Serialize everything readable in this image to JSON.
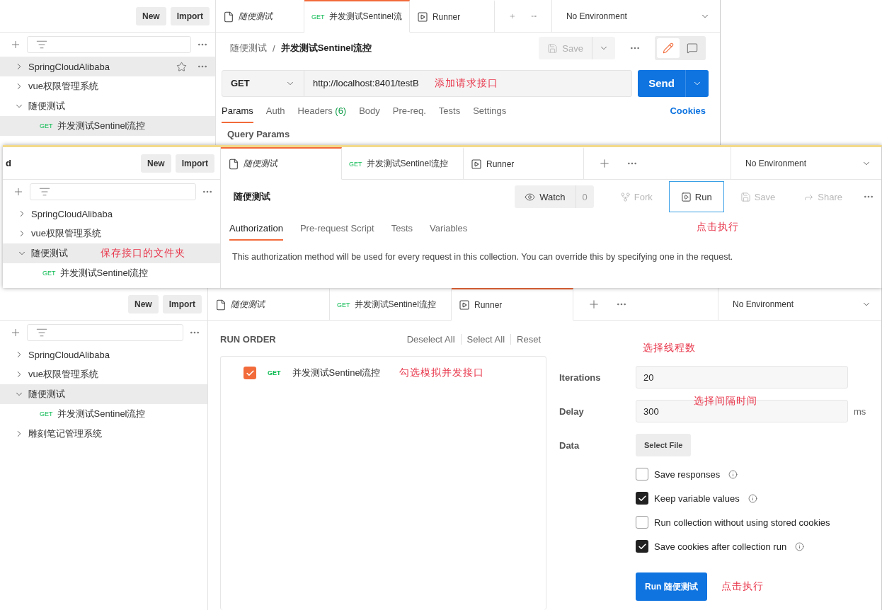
{
  "request_view": {
    "sidebar": {
      "buttons": [
        "New",
        "Import"
      ],
      "items": [
        {
          "label": "SpringCloudAlibaba",
          "expanded": false,
          "selected": true,
          "hovered": true
        },
        {
          "label": "vue权限管理系统",
          "expanded": false,
          "selected": false,
          "hovered": false
        },
        {
          "label": "随便测试",
          "expanded": true,
          "selected": false,
          "hovered": false,
          "children": [
            {
              "method": "GET",
              "label": "并发测试Sentinel流控",
              "selected": true
            }
          ]
        }
      ]
    },
    "tabs": [
      {
        "kind": "collection",
        "label": "随便测试",
        "selected": false
      },
      {
        "kind": "request",
        "method": "GET",
        "label": "并发测试Sentinel流",
        "selected": true
      },
      {
        "kind": "runner",
        "label": "Runner",
        "selected": false
      }
    ],
    "environment": "No Environment",
    "breadcrumb": [
      "随便测试",
      "/",
      "并发测试Sentinel流控"
    ],
    "save_button": {
      "label": "Save",
      "disabled": true
    },
    "method": "GET",
    "url": "http://localhost:8401/testB",
    "url_annotation": "添加请求接口",
    "send_button": "Send",
    "subtabs": [
      {
        "label": "Params",
        "selected": true
      },
      {
        "label": "Auth",
        "selected": false
      },
      {
        "label": "Headers",
        "count": "(6)",
        "selected": false
      },
      {
        "label": "Body",
        "selected": false
      },
      {
        "label": "Pre-req.",
        "selected": false
      },
      {
        "label": "Tests",
        "selected": false
      },
      {
        "label": "Settings",
        "selected": false
      }
    ],
    "cookies_link": "Cookies",
    "section_title": "Query Params"
  },
  "collection_view": {
    "sidebar": {
      "header_title": "d",
      "buttons": [
        "New",
        "Import"
      ],
      "items": [
        {
          "label": "SpringCloudAlibaba",
          "expanded": false,
          "selected": false
        },
        {
          "label": "vue权限管理系统",
          "expanded": false,
          "selected": false
        },
        {
          "label": "随便测试",
          "expanded": true,
          "selected": true,
          "annotation": "保存接口的文件夹",
          "children": [
            {
              "method": "GET",
              "label": "并发测试Sentinel流控",
              "selected": false
            }
          ]
        }
      ]
    },
    "tabs": [
      {
        "kind": "collection",
        "label": "随便测试",
        "selected": true
      },
      {
        "kind": "request",
        "method": "GET",
        "label": "并发测试Sentinel流控",
        "selected": false
      },
      {
        "kind": "runner",
        "label": "Runner",
        "selected": false
      }
    ],
    "environment": "No Environment",
    "title": "随便测试",
    "watch_button": {
      "label": "Watch",
      "count": "0"
    },
    "actions": [
      {
        "kind": "fork",
        "label": "Fork",
        "disabled": true,
        "highlighted": false
      },
      {
        "kind": "run",
        "label": "Run",
        "disabled": false,
        "highlighted": true
      },
      {
        "kind": "save",
        "label": "Save",
        "disabled": true,
        "highlighted": false
      },
      {
        "kind": "share",
        "label": "Share",
        "disabled": true,
        "highlighted": false
      }
    ],
    "run_annotation": "点击执行",
    "subtabs": [
      {
        "label": "Authorization",
        "selected": true
      },
      {
        "label": "Pre-request Script",
        "selected": false
      },
      {
        "label": "Tests",
        "selected": false
      },
      {
        "label": "Variables",
        "selected": false
      }
    ],
    "description": "This authorization method will be used for every request in this collection. You can override this by specifying one in the request."
  },
  "runner_view": {
    "sidebar": {
      "buttons": [
        "New",
        "Import"
      ],
      "items": [
        {
          "label": "SpringCloudAlibaba",
          "expanded": false,
          "selected": false
        },
        {
          "label": "vue权限管理系统",
          "expanded": false,
          "selected": false
        },
        {
          "label": "随便测试",
          "expanded": true,
          "selected": true,
          "children": [
            {
              "method": "GET",
              "label": "并发测试Sentinel流控",
              "selected": false
            }
          ]
        },
        {
          "label": "雕刻笔记管理系统",
          "expanded": false,
          "selected": false
        }
      ]
    },
    "tabs": [
      {
        "kind": "collection",
        "label": "随便测试",
        "selected": false
      },
      {
        "kind": "request",
        "method": "GET",
        "label": "并发测试Sentinel流控",
        "selected": false
      },
      {
        "kind": "runner",
        "label": "Runner",
        "selected": true
      }
    ],
    "environment": "No Environment",
    "run_order": {
      "title": "RUN ORDER",
      "links": [
        "Deselect All",
        "Select All",
        "Reset"
      ],
      "items": [
        {
          "checked": true,
          "method": "GET",
          "label": "并发测试Sentinel流控",
          "annotation": "勾选模拟并发接口"
        }
      ]
    },
    "settings": {
      "iterations": {
        "label": "Iterations",
        "value": "20",
        "annotation": "选择线程数"
      },
      "delay": {
        "label": "Delay",
        "value": "300",
        "unit": "ms",
        "annotation": "选择间隔时间"
      },
      "data": {
        "label": "Data",
        "button": "Select File"
      },
      "options": [
        {
          "label": "Save responses",
          "checked": false,
          "info": true
        },
        {
          "label": "Keep variable values",
          "checked": true,
          "info": true
        },
        {
          "label": "Run collection without using stored cookies",
          "checked": false,
          "info": false
        },
        {
          "label": "Save cookies after collection run",
          "checked": true,
          "info": true
        }
      ],
      "run_button": "Run 随便测试",
      "run_annotation": "点击执行"
    }
  }
}
